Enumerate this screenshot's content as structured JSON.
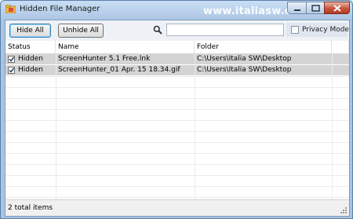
{
  "window": {
    "title": "Hidden File Manager",
    "watermark": "www.italiasw.com"
  },
  "toolbar": {
    "hide_all_label": "Hide All",
    "unhide_all_label": "Unhide All",
    "search_value": "",
    "search_icon": "search-icon",
    "privacy_mode_label": "Privacy Mode",
    "privacy_mode_checked": false
  },
  "grid": {
    "columns": [
      "Status",
      "Name",
      "Folder"
    ],
    "rows": [
      {
        "checked": true,
        "status": "Hidden",
        "name": "ScreenHunter 5.1 Free.lnk",
        "folder": "C:\\Users\\Italia SW\\Desktop"
      },
      {
        "checked": true,
        "status": "Hidden",
        "name": "ScreenHunter_01 Apr. 15 18.34.gif",
        "folder": "C:\\Users\\Italia SW\\Desktop"
      }
    ]
  },
  "statusbar": {
    "text": "2 total items"
  },
  "colors": {
    "selected_row": "#d4d4d4",
    "title_bar": "#b9d1ec",
    "close_button": "#c8553d"
  }
}
